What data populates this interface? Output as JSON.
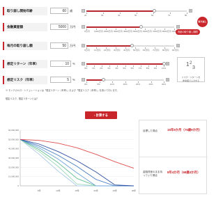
{
  "inputs": [
    {
      "label": "取り崩し開始年齢",
      "value": "60",
      "unit": "歳",
      "slider_fraction": 0.68,
      "ticks": [
        "20",
        "30",
        "40",
        "50",
        "60",
        "70",
        "80"
      ]
    },
    {
      "label": "金融資産額",
      "value": "5000",
      "unit": "万円",
      "slider_fraction": 0.62,
      "ticks": [
        "0万円",
        "1000万円",
        "2000万円",
        "3000万円",
        "4000万円",
        "5000万円",
        "6000万円",
        "7000万円",
        "8000万円",
        "9000万円"
      ]
    },
    {
      "label": "毎月の取り崩し額",
      "value": "50",
      "unit": "万円",
      "slider_fraction": 0.52,
      "ticks": [
        "0万円",
        "10万円",
        "20万円",
        "30万円",
        "40万円",
        "50万円",
        "60万円",
        "70万円",
        "80万円",
        "90万円"
      ]
    },
    {
      "label": "想定リターン（年率）",
      "value": "10",
      "unit": "%",
      "slider_fraction": 1.0,
      "ticks": [
        "0%",
        "1%",
        "2%",
        "3%",
        "4%",
        "5%",
        "6%",
        "7%",
        "8%",
        "9%",
        "10%"
      ]
    },
    {
      "label": "想定リスク（年率）",
      "value": "5",
      "unit": "%",
      "slider_fraction": 0.22,
      "ticks": [
        "0%",
        "5%",
        "10%",
        "15%",
        "20%",
        "25%",
        "30%"
      ]
    }
  ],
  "bubble_label": "資産の取り崩し期間",
  "badge_label": "取り崩し",
  "side_card": {
    "title": "リスク・リターンを",
    "subtitle": "参考値で入力する"
  },
  "notes": [
    "※ モンテカルロ・シミュレーションは「想定リターン（年率）」および「想定リスク（年率）」を用いて行います。",
    "想定リスク、想定リターンとは？"
  ],
  "calculate_label": "計算する",
  "chart_data": {
    "type": "line",
    "ylim": [
      0,
      60000000
    ],
    "x": [
      0,
      5,
      10,
      15,
      20,
      25,
      30
    ],
    "xlim": [
      0,
      30
    ],
    "yticks": [
      "60,000,000",
      "50,000,000",
      "40,000,000",
      "30,000,000",
      "20,000,000",
      "10,000,000",
      "0"
    ],
    "xticks": [
      "5年",
      "10年",
      "15年",
      "20年",
      "25年",
      "30年"
    ],
    "series": [
      {
        "color": "#e05050",
        "values": [
          50000000,
          49000000,
          46000000,
          41000000,
          34000000,
          26000000,
          19000000
        ]
      },
      {
        "color": "#2f4fa0",
        "values": [
          50000000,
          45000000,
          37000000,
          27000000,
          15000000,
          1000000,
          0
        ]
      },
      {
        "color": "#4a7fc0",
        "values": [
          50000000,
          43000000,
          33000000,
          21000000,
          7000000,
          0,
          0
        ]
      },
      {
        "color": "#6fa4d8",
        "values": [
          50000000,
          41000000,
          29000000,
          14000000,
          0,
          0,
          0
        ]
      },
      {
        "color": "#5fbf8f",
        "values": [
          50000000,
          39000000,
          25000000,
          8000000,
          0,
          0,
          0
        ]
      },
      {
        "color": "#9fd9b8",
        "values": [
          50000000,
          37000000,
          21000000,
          2000000,
          0,
          0,
          0
        ]
      },
      {
        "color": "#a9c8e6",
        "values": [
          50000000,
          34000000,
          16000000,
          0,
          0,
          0,
          0
        ]
      }
    ]
  },
  "results": {
    "median_label": "目標した場合",
    "median_value": "16年9か月（76歳9か月）",
    "worst_label": "金融資産のまま持っていた場合",
    "worst_value": "8年4か月（68歳4か月）"
  },
  "colors": {
    "accent": "#c8262b"
  }
}
